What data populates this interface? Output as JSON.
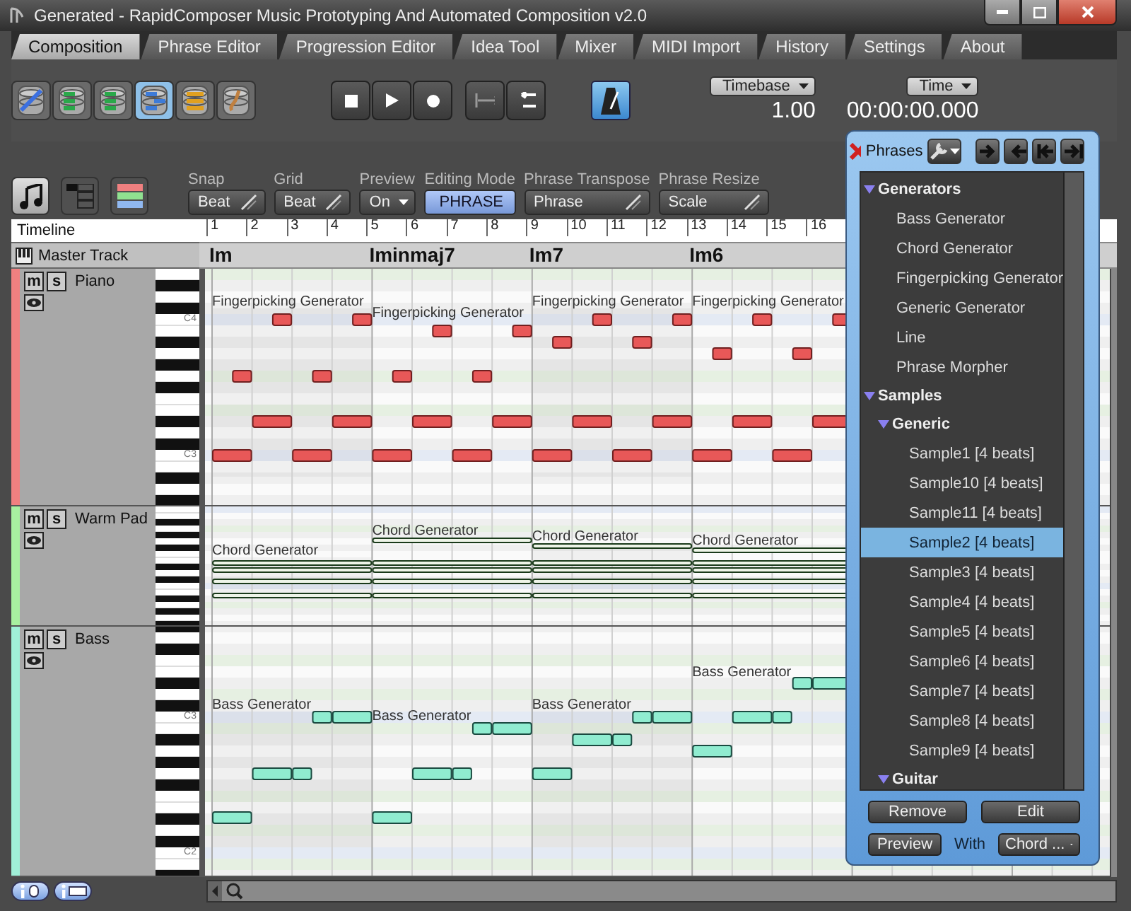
{
  "window": {
    "title": "Generated - RapidComposer Music Prototyping And Automated Composition v2.0"
  },
  "tabs": [
    {
      "label": "Composition",
      "selected": true
    },
    {
      "label": "Phrase Editor",
      "selected": false
    },
    {
      "label": "Progression Editor",
      "selected": false
    },
    {
      "label": "Idea Tool",
      "selected": false
    },
    {
      "label": "Mixer",
      "selected": false
    },
    {
      "label": "MIDI Import",
      "selected": false
    },
    {
      "label": "History",
      "selected": false
    },
    {
      "label": "Settings",
      "selected": false
    },
    {
      "label": "About",
      "selected": false
    }
  ],
  "tools": [
    {
      "selected": false
    },
    {
      "selected": false
    },
    {
      "selected": false
    },
    {
      "selected": true
    },
    {
      "selected": false
    },
    {
      "selected": false
    }
  ],
  "metronome": {
    "on": true
  },
  "timebase": {
    "label": "Timebase",
    "value": "1.00"
  },
  "time": {
    "label": "Time",
    "value": "00:00:00.000"
  },
  "views": [
    {
      "selected": true
    },
    {
      "selected": false
    },
    {
      "selected": false
    }
  ],
  "controls": [
    {
      "label": "Snap",
      "value": "Beat",
      "kind": "combo"
    },
    {
      "label": "Grid",
      "value": "Beat",
      "kind": "combo"
    },
    {
      "label": "Preview",
      "value": "On",
      "kind": "dropdown"
    },
    {
      "label": "Editing Mode",
      "value": "PHRASE",
      "kind": "toggle"
    },
    {
      "label": "Phrase Transpose",
      "value": "Phrase",
      "kind": "combo"
    },
    {
      "label": "Phrase Resize",
      "value": "Scale",
      "kind": "combo"
    }
  ],
  "timeline": {
    "label": "Timeline",
    "beats": [
      "1",
      "2",
      "3",
      "4",
      "5",
      "6",
      "7",
      "8",
      "9",
      "10",
      "11",
      "12",
      "13",
      "14",
      "15",
      "16"
    ]
  },
  "master_track": {
    "name": "Master Track",
    "chords": [
      "Im",
      "Iminmaj7",
      "Im7",
      "Im6"
    ]
  },
  "tracks": [
    {
      "name": "Piano",
      "color": "#f08080",
      "mute": "m",
      "solo": "s",
      "key_labels": [
        "C4",
        "C3"
      ],
      "phrases": [
        "Fingerpicking Generator",
        "Fingerpicking Generator",
        "Fingerpicking Generator",
        "Fingerpicking Generator"
      ]
    },
    {
      "name": "Warm Pad",
      "color": "#a8f0a0",
      "mute": "m",
      "solo": "s",
      "phrases": [
        "Chord Generator",
        "Chord Generator",
        "Chord Generator",
        "Chord Generator"
      ]
    },
    {
      "name": "Bass",
      "color": "#a0f0d8",
      "mute": "m",
      "solo": "s",
      "key_labels": [
        "C3",
        "C2"
      ],
      "phrases": [
        "Bass Generator",
        "Bass Generator",
        "Bass Generator",
        "Bass Generator"
      ]
    }
  ],
  "panel": {
    "title": "Phrases",
    "tree": [
      {
        "label": "Generators",
        "expanded": true,
        "children": [
          {
            "label": "Bass Generator",
            "selected": false
          },
          {
            "label": "Chord Generator",
            "selected": false
          },
          {
            "label": "Fingerpicking Generator",
            "selected": false
          },
          {
            "label": "Generic Generator",
            "selected": false
          },
          {
            "label": "Line",
            "selected": false
          },
          {
            "label": "Phrase Morpher",
            "selected": false
          }
        ]
      },
      {
        "label": "Samples",
        "expanded": true,
        "children": [
          {
            "label": "Generic",
            "expanded": true,
            "children": [
              {
                "label": "Sample1 [4 beats]",
                "selected": false
              },
              {
                "label": "Sample10 [4 beats]",
                "selected": false
              },
              {
                "label": "Sample11 [4 beats]",
                "selected": false
              },
              {
                "label": "Sample2 [4 beats]",
                "selected": true
              },
              {
                "label": "Sample3 [4 beats]",
                "selected": false
              },
              {
                "label": "Sample4 [4 beats]",
                "selected": false
              },
              {
                "label": "Sample5 [4 beats]",
                "selected": false
              },
              {
                "label": "Sample6 [4 beats]",
                "selected": false
              },
              {
                "label": "Sample7 [4 beats]",
                "selected": false
              },
              {
                "label": "Sample8 [4 beats]",
                "selected": false
              },
              {
                "label": "Sample9 [4 beats]",
                "selected": false
              }
            ]
          },
          {
            "label": "Guitar",
            "expanded": true
          }
        ]
      }
    ],
    "buttons": [
      "Remove",
      "Edit"
    ],
    "preview": {
      "button": "Preview",
      "with": "With",
      "value": "Chord ..."
    }
  }
}
